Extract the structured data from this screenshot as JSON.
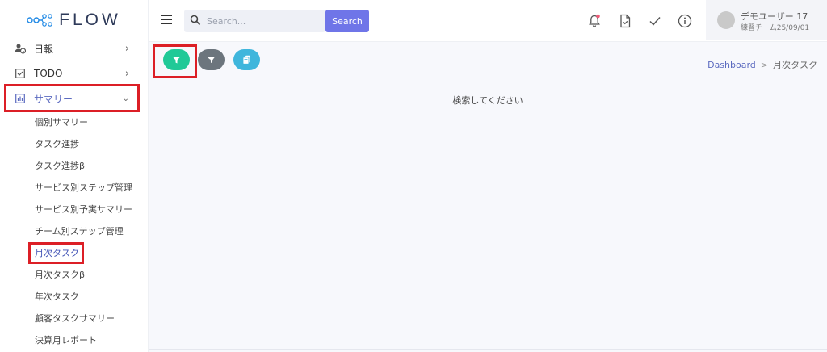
{
  "brand": {
    "name": "FLOW"
  },
  "sidebar": {
    "items": [
      {
        "label": "日報",
        "icon": "user-clock-icon",
        "expanded": false
      },
      {
        "label": "TODO",
        "icon": "checkbox-icon",
        "expanded": false
      },
      {
        "label": "サマリー",
        "icon": "chart-icon",
        "expanded": true
      }
    ],
    "sub_items": [
      {
        "label": "個別サマリー"
      },
      {
        "label": "タスク進捗"
      },
      {
        "label": "タスク進捗β"
      },
      {
        "label": "サービス別ステップ管理"
      },
      {
        "label": "サービス別予実サマリー"
      },
      {
        "label": "チーム別ステップ管理"
      },
      {
        "label": "月次タスク",
        "active": true
      },
      {
        "label": "月次タスクβ"
      },
      {
        "label": "年次タスク"
      },
      {
        "label": "顧客タスクサマリー"
      },
      {
        "label": "決算月レポート"
      }
    ]
  },
  "header": {
    "search_placeholder": "Search...",
    "search_button": "Search",
    "icons": [
      "bell-icon",
      "document-icon",
      "check-icon",
      "info-icon"
    ],
    "user": {
      "name": "デモユーザー 17",
      "team": "練習チーム25/09/01"
    }
  },
  "toolbar": {
    "buttons": [
      {
        "name": "filter-button",
        "icon": "filter-icon",
        "color": "#20c997"
      },
      {
        "name": "clear-filter-button",
        "icon": "filter-clear-icon",
        "color": "#6c757d"
      },
      {
        "name": "copy-button",
        "icon": "copy-icon",
        "color": "#3fb6dc"
      }
    ]
  },
  "breadcrumb": {
    "home": "Dashboard",
    "separator": ">",
    "current": "月次タスク"
  },
  "main": {
    "empty_message": "検索してください"
  },
  "colors": {
    "accent": "#6f75e8",
    "active_text": "#3f51b5",
    "highlight": "#dc1f26"
  }
}
